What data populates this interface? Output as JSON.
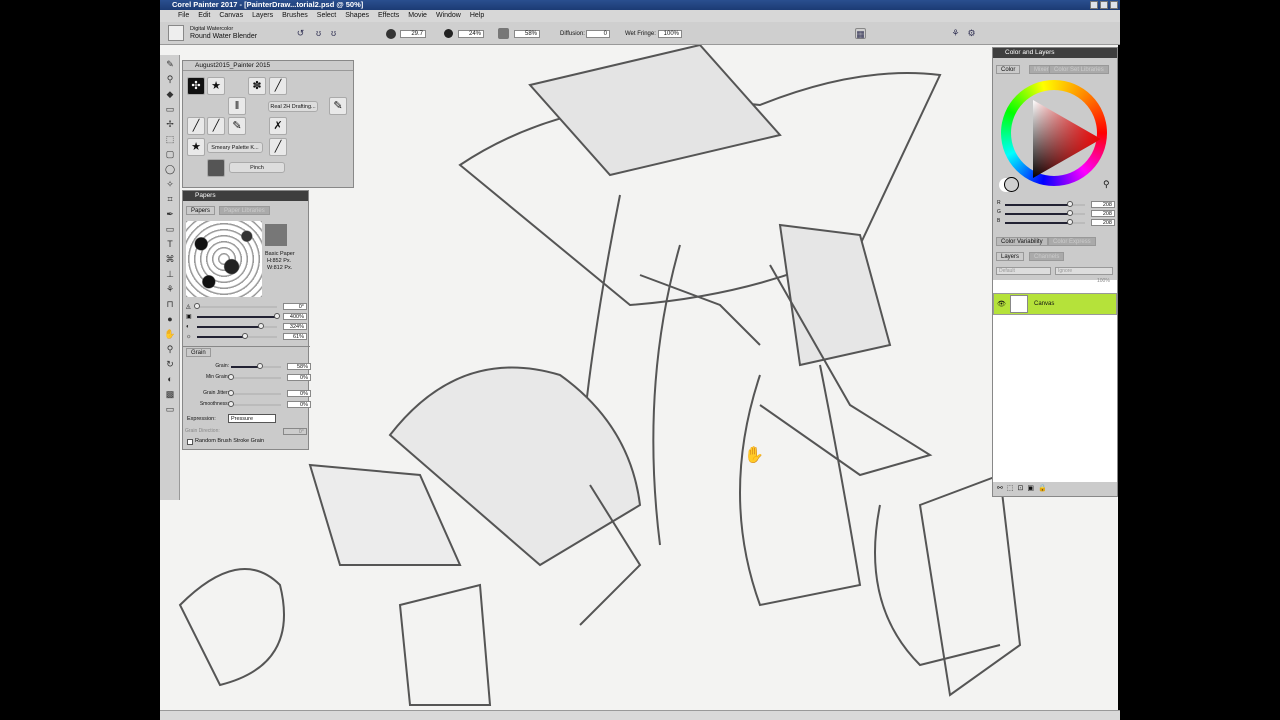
{
  "window": {
    "title": "Corel Painter 2017 - [PainterDraw...torial2.psd @ 50%]"
  },
  "menu": [
    "File",
    "Edit",
    "Canvas",
    "Layers",
    "Brushes",
    "Select",
    "Shapes",
    "Effects",
    "Movie",
    "Window",
    "Help"
  ],
  "property_bar": {
    "brush_category": "Digital Watercolor",
    "brush_variant": "Round Water Blender",
    "size": "29.7",
    "opacity": "24%",
    "grain": "58%",
    "diffusion_label": "Diffusion:",
    "diffusion": "0",
    "wet_fringe_label": "Wet Fringe:",
    "wet_fringe": "100%"
  },
  "brush_panel": {
    "title": "August2015_Painter 2015",
    "items": [
      "Real 2H Drafting...",
      "Smeary Palette K...",
      "Pinch"
    ]
  },
  "papers_panel": {
    "title": "Papers",
    "tabs": [
      "Papers",
      "Paper Libraries"
    ],
    "paper_name": "Basic Paper",
    "height": "H:852 Px.",
    "width": "W:812 Px.",
    "sliders": [
      {
        "value": "0°",
        "level": 0
      },
      {
        "value": "400%",
        "level": 1
      },
      {
        "value": "324%",
        "level": 0.8
      },
      {
        "value": "61%",
        "level": 0.6
      }
    ]
  },
  "grain_panel": {
    "title": "Grain",
    "rows": [
      {
        "label": "Grain:",
        "value": "58%",
        "level": 0.58
      },
      {
        "label": "Min Grain:",
        "value": "0%",
        "level": 0
      },
      {
        "label": "Grain Jitter:",
        "value": "0%",
        "level": 0
      },
      {
        "label": "Smoothness:",
        "value": "0%",
        "level": 0
      }
    ],
    "expression_label": "Expression:",
    "expression": "Pressure",
    "direction_label": "Grain Direction:",
    "direction": "0°",
    "random_label": "Random Brush Stroke Grain"
  },
  "color_panel": {
    "title": "Color and Layers",
    "tabs": [
      "Color",
      "Mixer",
      "Color Set Libraries"
    ],
    "r": "208",
    "g": "208",
    "b": "208",
    "current_color": "#d0d0d0"
  },
  "variability": {
    "tabs": [
      "Color Variability",
      "Color Express"
    ]
  },
  "layers": {
    "tabs": [
      "Layers",
      "Channels"
    ],
    "composite": "Default",
    "method": "Ignore",
    "opacity": "100%",
    "items": [
      {
        "name": "Canvas",
        "highlight": "#b5e23a"
      }
    ]
  }
}
